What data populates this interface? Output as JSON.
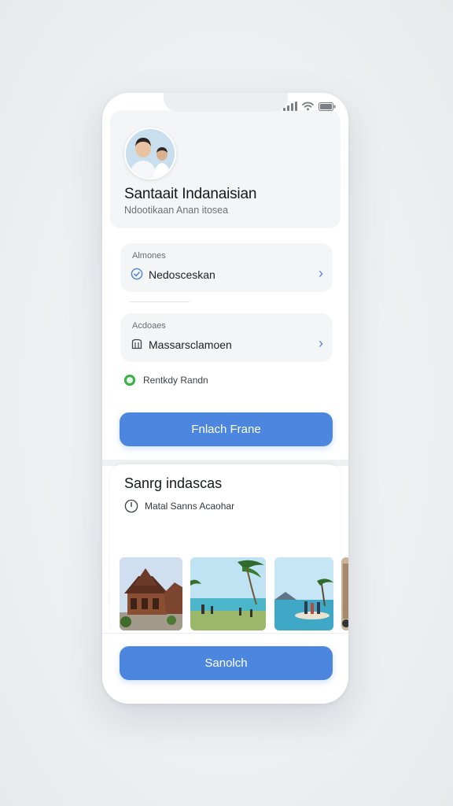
{
  "profile": {
    "name": "Santaait Indanaisian",
    "subtitle": "Ndootikaan Anan itosea"
  },
  "fields": [
    {
      "label": "Almones",
      "value": "Nedosceskan",
      "icon": "check-circle-icon"
    },
    {
      "label": "Acdoaes",
      "value": "Massarsclamoen",
      "icon": "building-icon"
    }
  ],
  "status": {
    "text": "Rentkdy Randn",
    "color": "#3fb04b"
  },
  "primary_button": {
    "label": "Fnlach Frane"
  },
  "section": {
    "title": "Sanrg indascas",
    "meta": "Matal Sanns Acaohar",
    "meta_icon": "clock-icon"
  },
  "gallery": [
    {
      "name": "traditional-house-photo"
    },
    {
      "name": "beach-palm-photo"
    },
    {
      "name": "lagoon-people-photo"
    },
    {
      "name": "temple-photo"
    }
  ],
  "bottom_button": {
    "label": "Sanolch"
  },
  "colors": {
    "accent": "#4d86df",
    "chevron": "#4a84d8",
    "card": "#f4f5f7"
  }
}
